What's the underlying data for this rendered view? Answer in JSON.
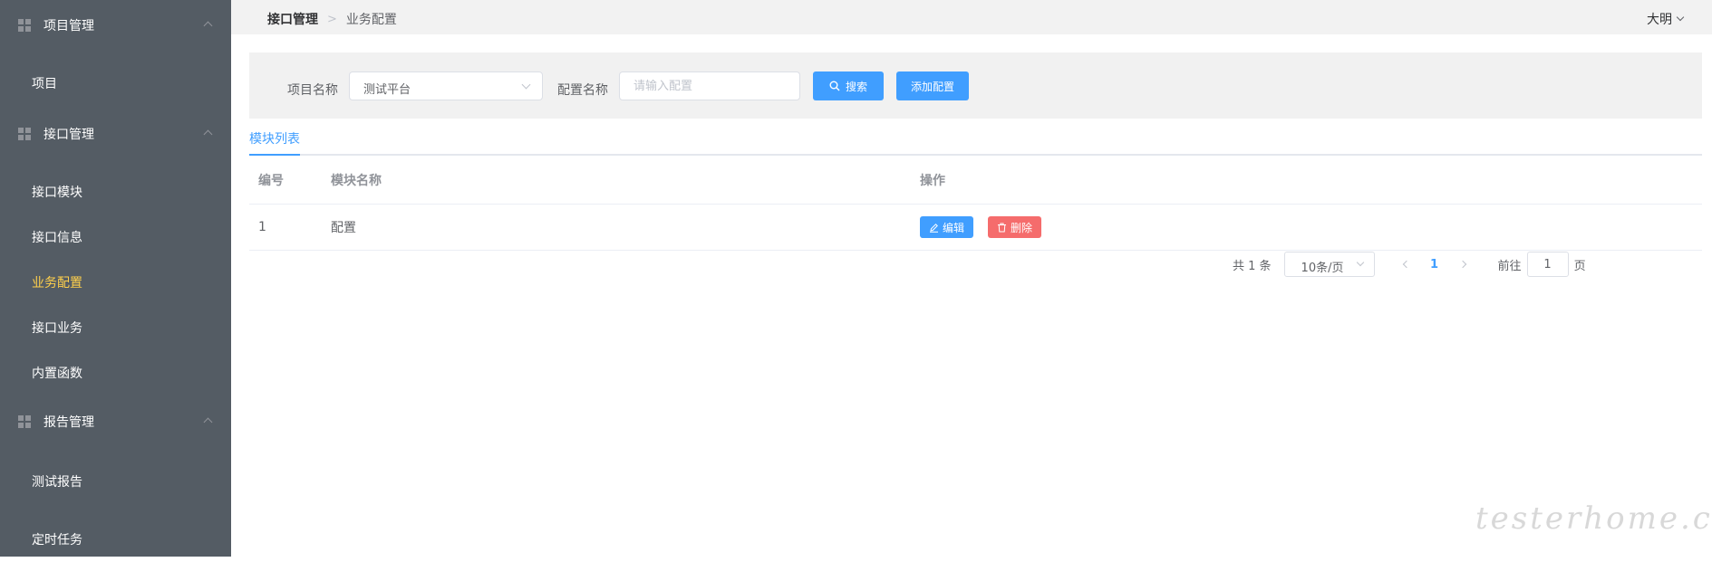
{
  "sidebar": {
    "groups": [
      {
        "title": "项目管理",
        "items": [
          {
            "label": "项目"
          }
        ]
      },
      {
        "title": "接口管理",
        "items": [
          {
            "label": "接口模块"
          },
          {
            "label": "接口信息"
          },
          {
            "label": "业务配置",
            "active": true
          },
          {
            "label": "接口业务"
          },
          {
            "label": "内置函数"
          }
        ]
      },
      {
        "title": "报告管理",
        "items": [
          {
            "label": "测试报告"
          },
          {
            "label": "定时任务"
          }
        ]
      }
    ]
  },
  "header": {
    "breadcrumb": [
      "接口管理",
      "业务配置"
    ],
    "user": "大明"
  },
  "filter": {
    "project_label": "项目名称",
    "project_value": "测试平台",
    "config_label": "配置名称",
    "config_placeholder": "请输入配置",
    "search_label": "搜索",
    "add_label": "添加配置"
  },
  "tabs": [
    "模块列表"
  ],
  "table": {
    "columns": [
      "编号",
      "模块名称",
      "操作"
    ],
    "rows": [
      {
        "id": "1",
        "name": "配置"
      }
    ],
    "edit_label": "编辑",
    "delete_label": "删除"
  },
  "pagination": {
    "total": "共 1 条",
    "page_size": "10条/页",
    "current": "1",
    "goto_label": "前往",
    "goto_value": "1",
    "page_suffix": "页"
  },
  "watermark": "testerhome.com",
  "colors": {
    "sidebar_bg": "#545c64",
    "active_menu": "#ffd04b",
    "primary": "#409eff",
    "danger": "#f56c6c"
  }
}
